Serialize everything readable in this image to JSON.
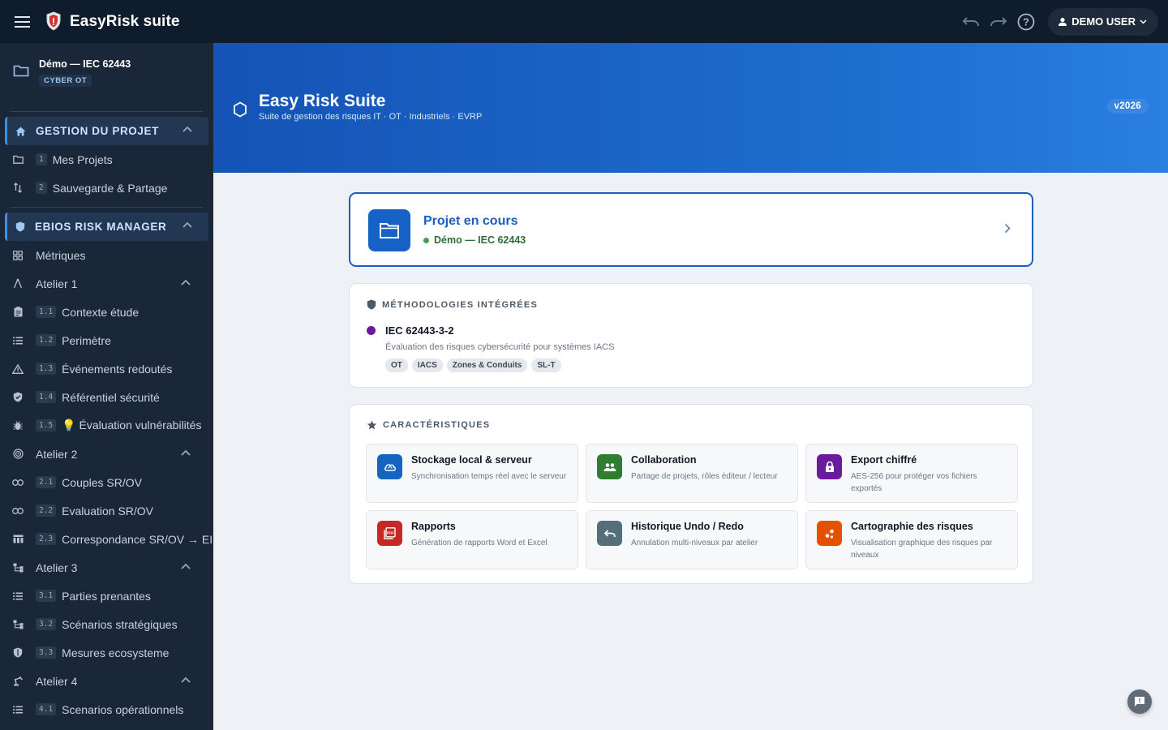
{
  "topbar": {
    "app_title": "EasyRisk suite",
    "user_label": "DEMO USER",
    "icons": [
      "menu-icon",
      "undo-icon",
      "redo-icon",
      "help-icon",
      "person-icon",
      "chevron-down-icon"
    ]
  },
  "sidebar": {
    "project_name": "Démo — IEC 62443",
    "project_badge": "CYBER OT",
    "sections": [
      {
        "label": "GESTION DU PROJET",
        "items": [
          {
            "num": "1",
            "label": "Mes Projets"
          },
          {
            "num": "2",
            "label": "Sauvegarde & Partage"
          }
        ]
      },
      {
        "label": "EBIOS RISK MANAGER",
        "items": [
          {
            "label": "Métriques"
          },
          {
            "label": "Atelier 1"
          },
          {
            "num": "1.1",
            "label": "Contexte étude"
          },
          {
            "num": "1.2",
            "label": "Perimètre"
          },
          {
            "num": "1.3",
            "label": "Événements redoutés"
          },
          {
            "num": "1.4",
            "label": "Référentiel sécurité"
          },
          {
            "num": "1.5",
            "label": "💡 Évaluation vulnérabilités"
          },
          {
            "label": "Atelier 2"
          },
          {
            "num": "2.1",
            "label": "Couples SR/OV"
          },
          {
            "num": "2.2",
            "label": "Evaluation SR/OV"
          },
          {
            "num": "2.3",
            "label": "Correspondance SR/OV → EI"
          },
          {
            "label": "Atelier 3"
          },
          {
            "num": "3.1",
            "label": "Parties prenantes"
          },
          {
            "num": "3.2",
            "label": "Scénarios stratégiques"
          },
          {
            "num": "3.3",
            "label": "Mesures ecosysteme"
          },
          {
            "label": "Atelier 4"
          },
          {
            "num": "4.1",
            "label": "Scenarios opérationnels"
          }
        ]
      }
    ]
  },
  "hero": {
    "title": "Easy Risk Suite",
    "subtitle": "Suite de gestion des risques IT · OT · Industriels · EVRP",
    "version": "v2026"
  },
  "current_project": {
    "title": "Projet en cours",
    "name": "Démo — IEC 62443",
    "status_color": "#43a047"
  },
  "methodologies": {
    "heading": "MÉTHODOLOGIES INTÉGRÉES",
    "items": [
      {
        "title": "IEC 62443-3-2",
        "description": "Évaluation des risques cybersécurité pour systèmes IACS",
        "color": "#6a1b9a",
        "tags": [
          "OT",
          "IACS",
          "Zones & Conduits",
          "SL-T"
        ]
      }
    ]
  },
  "features": {
    "heading": "CARACTÉRISTIQUES",
    "items": [
      {
        "title": "Stockage local & serveur",
        "description": "Synchronisation temps réel avec le serveur",
        "icon": "cloud-sync-icon",
        "color": "#1565c0"
      },
      {
        "title": "Collaboration",
        "description": "Partage de projets, rôles éditeur / lecteur",
        "icon": "people-icon",
        "color": "#2e7d32"
      },
      {
        "title": "Export chiffré",
        "description": "AES-256 pour protéger vos fichiers exportés",
        "icon": "lock-icon",
        "color": "#6a1b9a"
      },
      {
        "title": "Rapports",
        "description": "Génération de rapports Word et Excel",
        "icon": "pdf-icon",
        "color": "#c62828"
      },
      {
        "title": "Historique Undo / Redo",
        "description": "Annulation multi-niveaux par atelier",
        "icon": "undo-icon",
        "color": "#546e7a"
      },
      {
        "title": "Cartographie des risques",
        "description": "Visualisation graphique des risques par niveaux",
        "icon": "scatter-icon",
        "color": "#e65100"
      }
    ]
  }
}
